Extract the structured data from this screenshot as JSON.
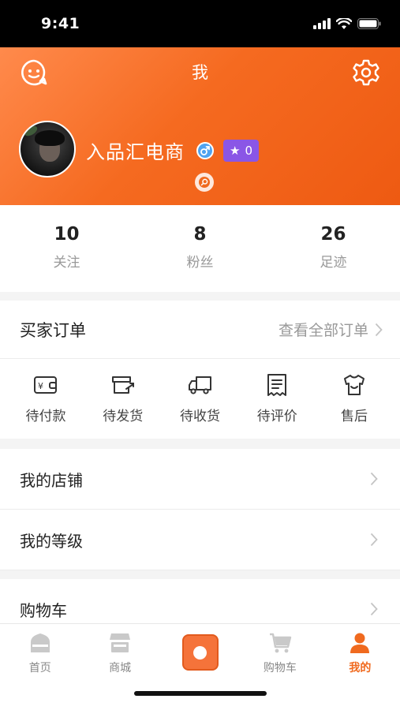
{
  "status_bar": {
    "time": "9:41"
  },
  "header": {
    "title": "我",
    "username": "入品汇电商",
    "star_count": "0"
  },
  "stats": [
    {
      "value": "10",
      "label": "关注"
    },
    {
      "value": "8",
      "label": "粉丝"
    },
    {
      "value": "26",
      "label": "足迹"
    }
  ],
  "orders": {
    "title": "买家订单",
    "view_all": "查看全部订单",
    "items": [
      {
        "label": "待付款",
        "icon": "wallet-icon"
      },
      {
        "label": "待发货",
        "icon": "package-send-icon"
      },
      {
        "label": "待收货",
        "icon": "truck-icon"
      },
      {
        "label": "待评价",
        "icon": "receipt-icon"
      },
      {
        "label": "售后",
        "icon": "shirt-icon"
      }
    ]
  },
  "menu": [
    {
      "label": "我的店铺"
    },
    {
      "label": "我的等级"
    },
    {
      "label": "购物车"
    }
  ],
  "tabbar": {
    "items": [
      {
        "label": "首页",
        "icon": "home-icon"
      },
      {
        "label": "商城",
        "icon": "store-icon"
      },
      {
        "label": "",
        "icon": "camera-icon"
      },
      {
        "label": "购物车",
        "icon": "cart-icon"
      },
      {
        "label": "我的",
        "icon": "person-icon"
      }
    ],
    "active_index": 4
  },
  "colors": {
    "accent": "#f06a1f",
    "header_gradient_start": "#ff8a4c",
    "header_gradient_end": "#ee5a12",
    "badge_purple": "#8a56e6",
    "gender_blue": "#4fa3f0"
  }
}
